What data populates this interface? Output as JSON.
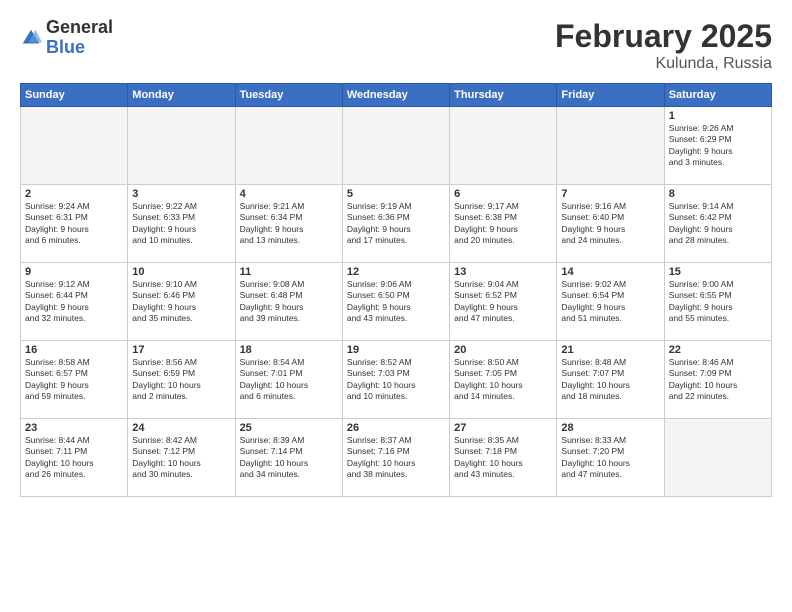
{
  "logo": {
    "general": "General",
    "blue": "Blue"
  },
  "title": "February 2025",
  "location": "Kulunda, Russia",
  "days_of_week": [
    "Sunday",
    "Monday",
    "Tuesday",
    "Wednesday",
    "Thursday",
    "Friday",
    "Saturday"
  ],
  "weeks": [
    [
      {
        "day": "",
        "info": ""
      },
      {
        "day": "",
        "info": ""
      },
      {
        "day": "",
        "info": ""
      },
      {
        "day": "",
        "info": ""
      },
      {
        "day": "",
        "info": ""
      },
      {
        "day": "",
        "info": ""
      },
      {
        "day": "1",
        "info": "Sunrise: 9:26 AM\nSunset: 6:29 PM\nDaylight: 9 hours\nand 3 minutes."
      }
    ],
    [
      {
        "day": "2",
        "info": "Sunrise: 9:24 AM\nSunset: 6:31 PM\nDaylight: 9 hours\nand 6 minutes."
      },
      {
        "day": "3",
        "info": "Sunrise: 9:22 AM\nSunset: 6:33 PM\nDaylight: 9 hours\nand 10 minutes."
      },
      {
        "day": "4",
        "info": "Sunrise: 9:21 AM\nSunset: 6:34 PM\nDaylight: 9 hours\nand 13 minutes."
      },
      {
        "day": "5",
        "info": "Sunrise: 9:19 AM\nSunset: 6:36 PM\nDaylight: 9 hours\nand 17 minutes."
      },
      {
        "day": "6",
        "info": "Sunrise: 9:17 AM\nSunset: 6:38 PM\nDaylight: 9 hours\nand 20 minutes."
      },
      {
        "day": "7",
        "info": "Sunrise: 9:16 AM\nSunset: 6:40 PM\nDaylight: 9 hours\nand 24 minutes."
      },
      {
        "day": "8",
        "info": "Sunrise: 9:14 AM\nSunset: 6:42 PM\nDaylight: 9 hours\nand 28 minutes."
      }
    ],
    [
      {
        "day": "9",
        "info": "Sunrise: 9:12 AM\nSunset: 6:44 PM\nDaylight: 9 hours\nand 32 minutes."
      },
      {
        "day": "10",
        "info": "Sunrise: 9:10 AM\nSunset: 6:46 PM\nDaylight: 9 hours\nand 35 minutes."
      },
      {
        "day": "11",
        "info": "Sunrise: 9:08 AM\nSunset: 6:48 PM\nDaylight: 9 hours\nand 39 minutes."
      },
      {
        "day": "12",
        "info": "Sunrise: 9:06 AM\nSunset: 6:50 PM\nDaylight: 9 hours\nand 43 minutes."
      },
      {
        "day": "13",
        "info": "Sunrise: 9:04 AM\nSunset: 6:52 PM\nDaylight: 9 hours\nand 47 minutes."
      },
      {
        "day": "14",
        "info": "Sunrise: 9:02 AM\nSunset: 6:54 PM\nDaylight: 9 hours\nand 51 minutes."
      },
      {
        "day": "15",
        "info": "Sunrise: 9:00 AM\nSunset: 6:55 PM\nDaylight: 9 hours\nand 55 minutes."
      }
    ],
    [
      {
        "day": "16",
        "info": "Sunrise: 8:58 AM\nSunset: 6:57 PM\nDaylight: 9 hours\nand 59 minutes."
      },
      {
        "day": "17",
        "info": "Sunrise: 8:56 AM\nSunset: 6:59 PM\nDaylight: 10 hours\nand 2 minutes."
      },
      {
        "day": "18",
        "info": "Sunrise: 8:54 AM\nSunset: 7:01 PM\nDaylight: 10 hours\nand 6 minutes."
      },
      {
        "day": "19",
        "info": "Sunrise: 8:52 AM\nSunset: 7:03 PM\nDaylight: 10 hours\nand 10 minutes."
      },
      {
        "day": "20",
        "info": "Sunrise: 8:50 AM\nSunset: 7:05 PM\nDaylight: 10 hours\nand 14 minutes."
      },
      {
        "day": "21",
        "info": "Sunrise: 8:48 AM\nSunset: 7:07 PM\nDaylight: 10 hours\nand 18 minutes."
      },
      {
        "day": "22",
        "info": "Sunrise: 8:46 AM\nSunset: 7:09 PM\nDaylight: 10 hours\nand 22 minutes."
      }
    ],
    [
      {
        "day": "23",
        "info": "Sunrise: 8:44 AM\nSunset: 7:11 PM\nDaylight: 10 hours\nand 26 minutes."
      },
      {
        "day": "24",
        "info": "Sunrise: 8:42 AM\nSunset: 7:12 PM\nDaylight: 10 hours\nand 30 minutes."
      },
      {
        "day": "25",
        "info": "Sunrise: 8:39 AM\nSunset: 7:14 PM\nDaylight: 10 hours\nand 34 minutes."
      },
      {
        "day": "26",
        "info": "Sunrise: 8:37 AM\nSunset: 7:16 PM\nDaylight: 10 hours\nand 38 minutes."
      },
      {
        "day": "27",
        "info": "Sunrise: 8:35 AM\nSunset: 7:18 PM\nDaylight: 10 hours\nand 43 minutes."
      },
      {
        "day": "28",
        "info": "Sunrise: 8:33 AM\nSunset: 7:20 PM\nDaylight: 10 hours\nand 47 minutes."
      },
      {
        "day": "",
        "info": ""
      }
    ]
  ]
}
